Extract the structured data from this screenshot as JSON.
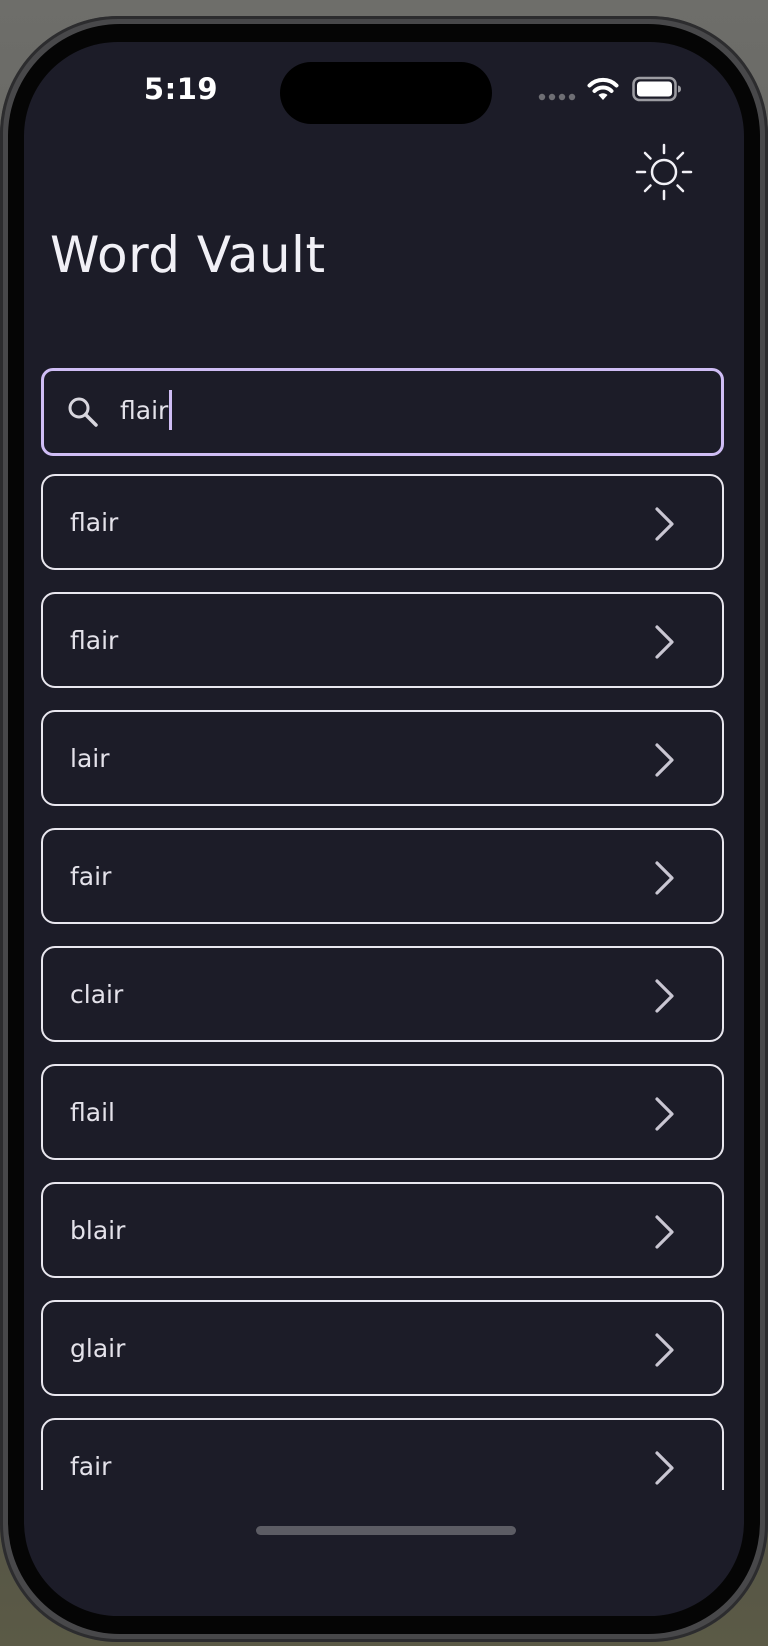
{
  "status_bar": {
    "time": "5:19",
    "wifi_icon": "wifi-icon",
    "battery_icon": "battery-icon",
    "signal_icon": "signal-dots-icon"
  },
  "app_bar": {
    "theme_toggle_icon": "sun-icon"
  },
  "page": {
    "title": "Word Vault"
  },
  "search": {
    "icon": "search-icon",
    "value": "flair"
  },
  "results": [
    {
      "word": "flair"
    },
    {
      "word": "flair"
    },
    {
      "word": "lair"
    },
    {
      "word": "fair"
    },
    {
      "word": "clair"
    },
    {
      "word": "flail"
    },
    {
      "word": "blair"
    },
    {
      "word": "glair"
    },
    {
      "word": "fair"
    }
  ],
  "colors": {
    "background": "#1c1c28",
    "accent": "#cfbdf5",
    "text": "#e4e2ea",
    "border": "#e9e7ef"
  }
}
